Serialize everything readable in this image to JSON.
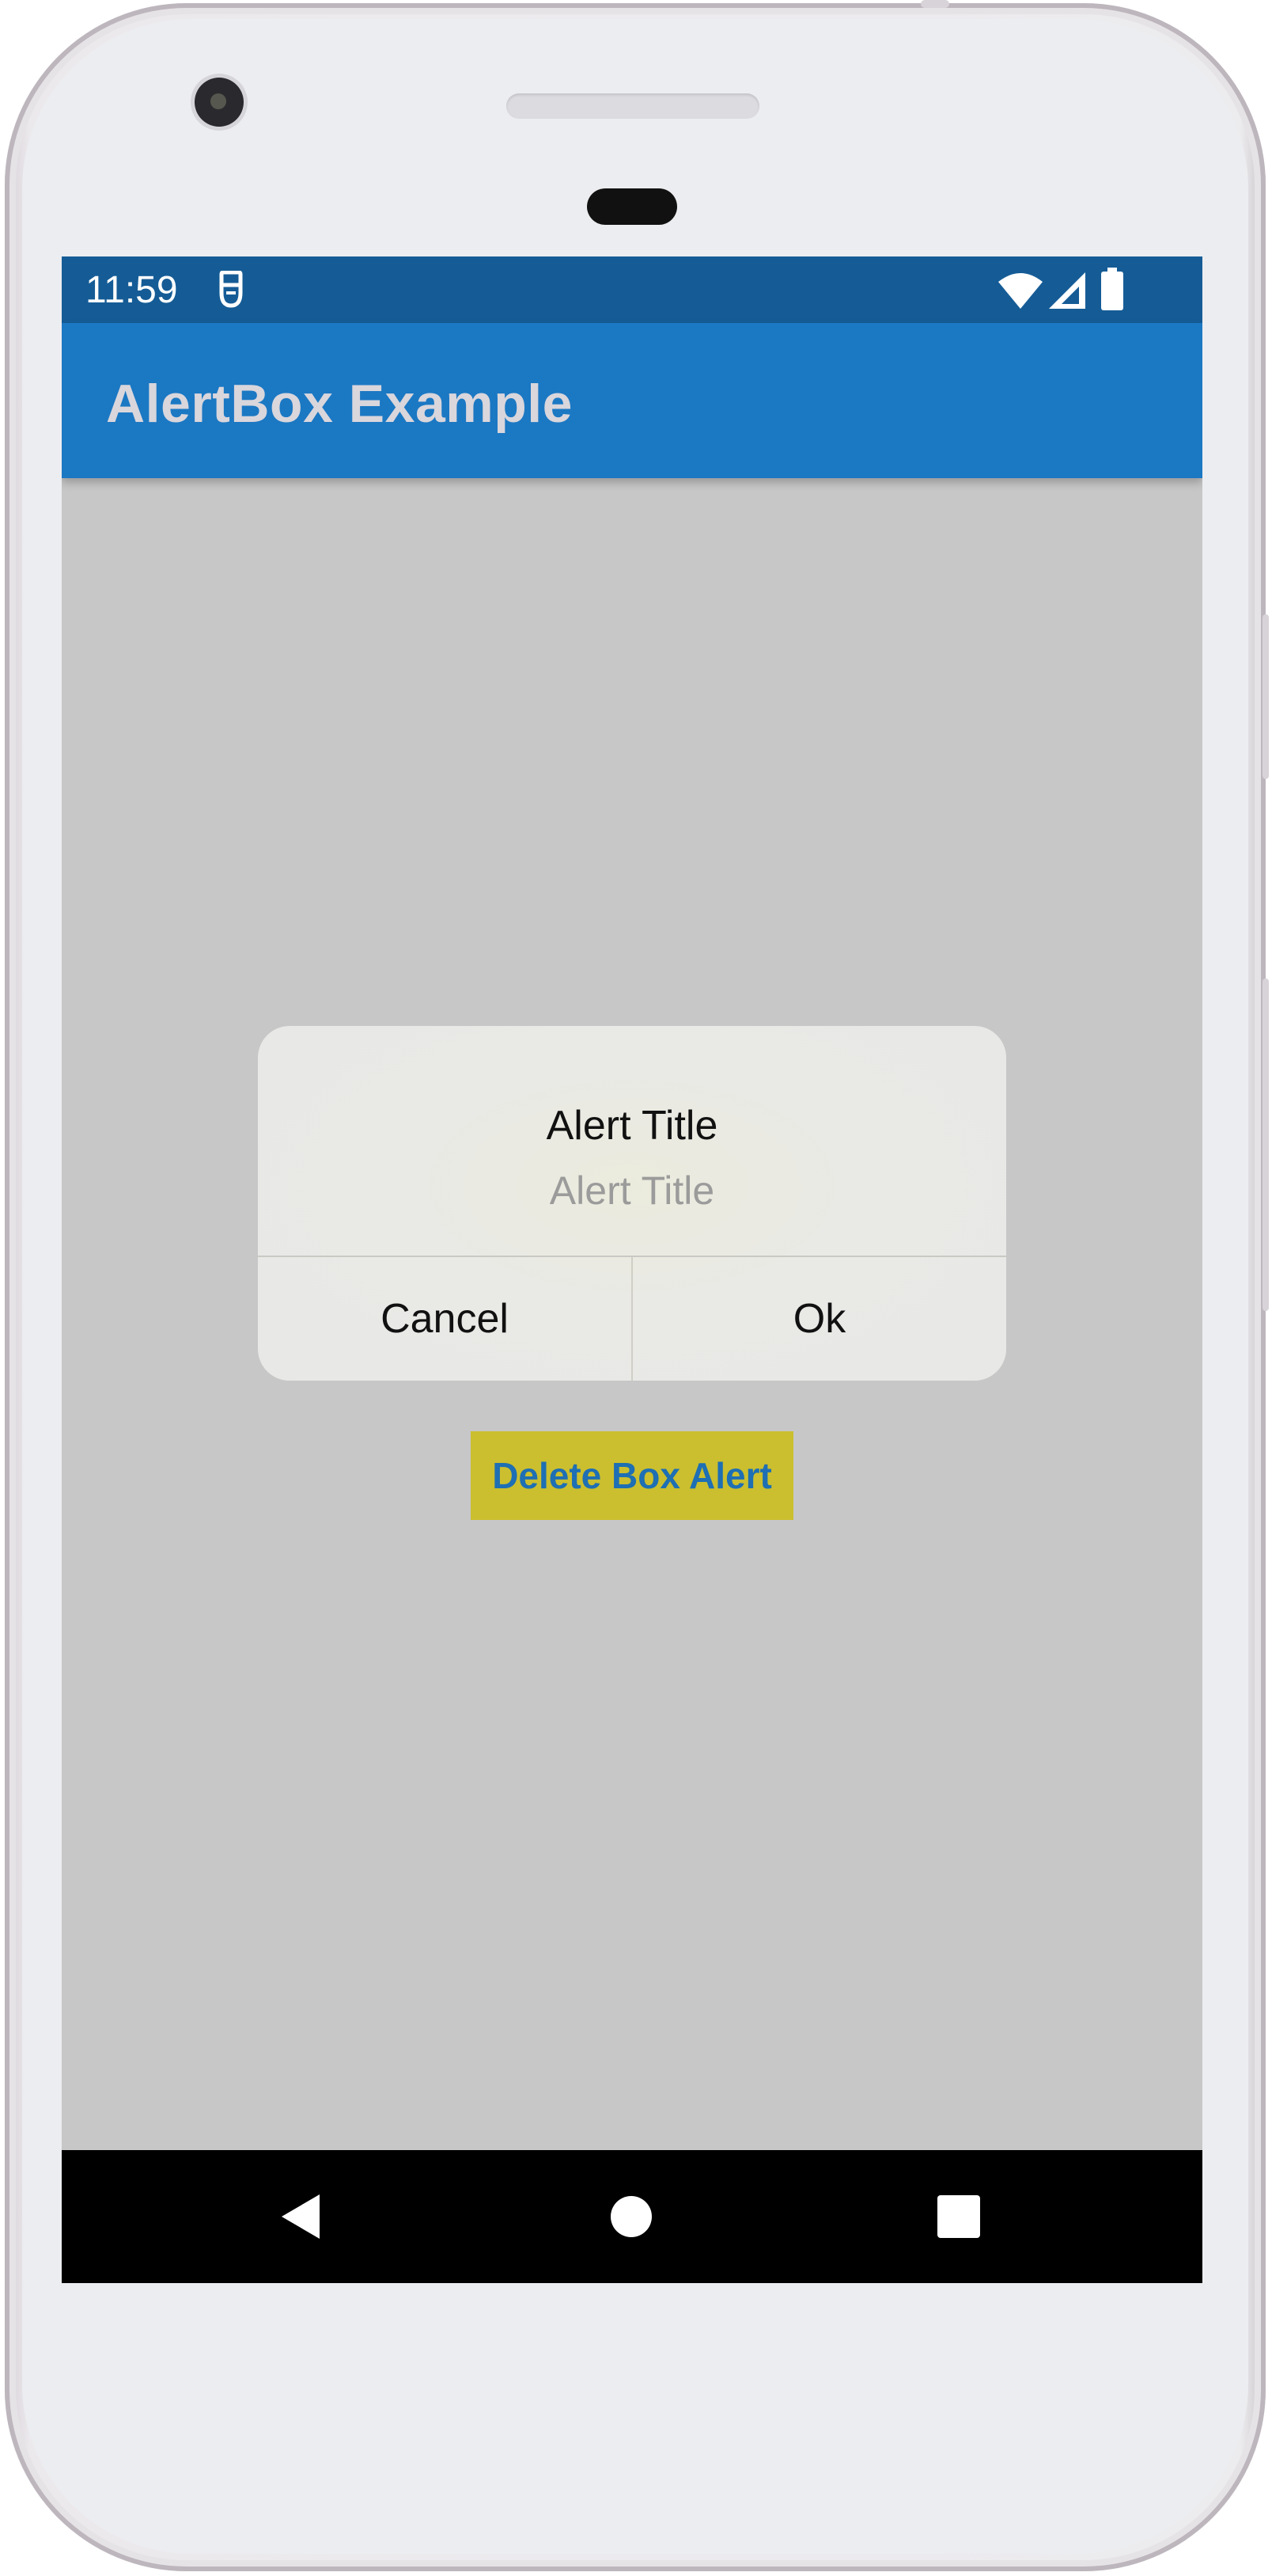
{
  "status_bar": {
    "time": "11:59",
    "icons": [
      "notification-app-icon",
      "wifi-icon",
      "cellular-signal-icon",
      "battery-icon"
    ]
  },
  "app_bar": {
    "title": "AlertBox Example"
  },
  "dialog": {
    "title": "Alert Title",
    "message": "Alert Title",
    "cancel_label": "Cancel",
    "ok_label": "Ok"
  },
  "main": {
    "action_button_label": "Delete Box Alert"
  },
  "nav_bar": {
    "items": [
      "back-icon",
      "home-icon",
      "recents-icon"
    ]
  },
  "colors": {
    "status_bar": "#155c96",
    "app_bar": "#1b78c3",
    "screen_background": "#c7c7c7",
    "action_button_background": "#cbbf2f",
    "action_button_text": "#1e6fb3",
    "nav_bar": "#000000"
  }
}
